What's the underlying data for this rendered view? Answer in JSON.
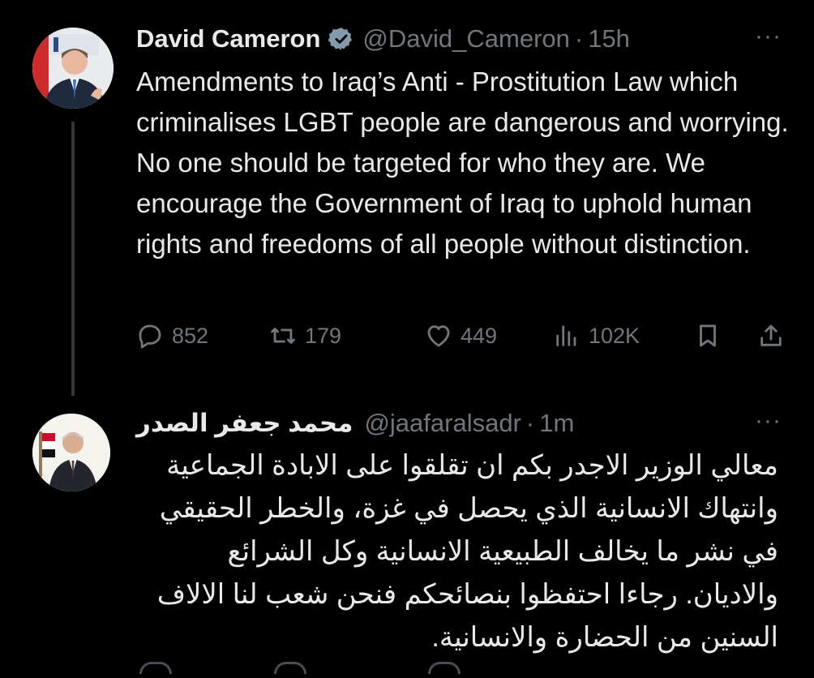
{
  "tweets": [
    {
      "name": "David Cameron",
      "handle": "@David_Cameron",
      "separator": "·",
      "time": "15h",
      "more": "···",
      "avatar_icon": "avatar-david-cameron",
      "verified_icon": "verified-badge-icon",
      "text": "Amendments to Iraq’s Anti - Prostitution Law which criminalises LGBT people are dangerous and worrying. No one should be targeted for who they are. We encourage the Government of Iraq to uphold human rights and freedoms of all people without distinction.",
      "actions": {
        "replies": "852",
        "retweets": "179",
        "likes": "449",
        "views": "102K"
      }
    },
    {
      "name": "محمد جعفر الصدر",
      "handle": "@jaafaralsadr",
      "separator": "·",
      "time": "1m",
      "more": "···",
      "avatar_icon": "avatar-jaafar-alsadr",
      "text": "معالي الوزير الاجدر بكم ان تقلقوا على الابادة الجماعية وانتهاك الانسانية الذي يحصل في غزة، والخطر الحقيقي في نشر ما يخالف الطبيعية الانسانية وكل الشرائع والاديان. رجاءا احتفظوا بنصائحكم فنحن شعب لنا الالاف السنين من الحضارة والانسانية."
    }
  ],
  "colors": {
    "background": "#000000",
    "primary_text": "#e7e9ea",
    "secondary_text": "#71767b",
    "verified": "#829aab",
    "thread_line": "#333639"
  }
}
